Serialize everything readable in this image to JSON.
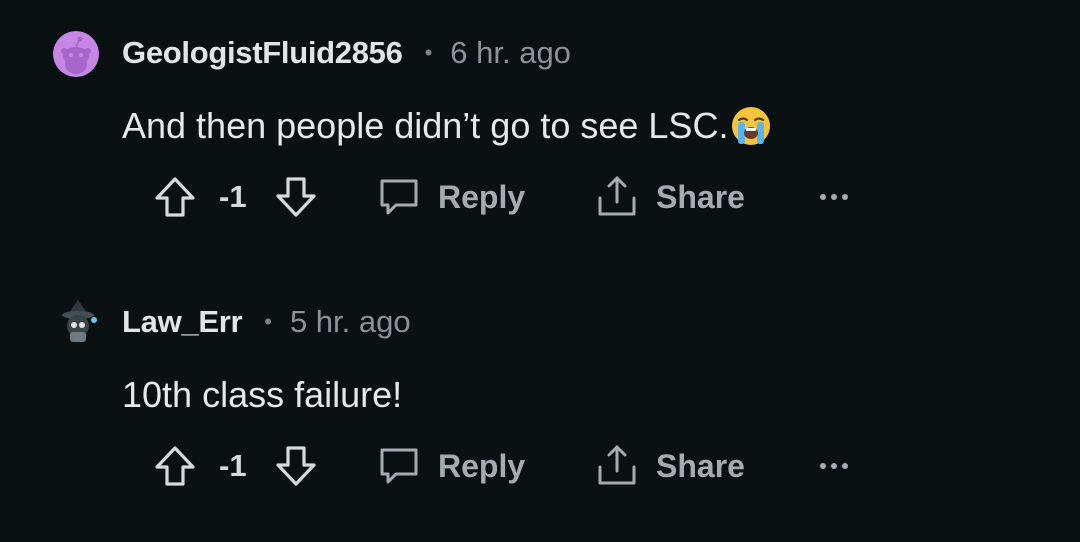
{
  "comments": [
    {
      "username": "GeologistFluid2856",
      "separator": "•",
      "time": "6 hr. ago",
      "text": "And then people didn’t go to see LSC.",
      "emoji": "loudly-crying-face-emoji",
      "score": "-1",
      "reply_label": "Reply",
      "share_label": "Share",
      "avatar_icon": "reddit-snoo-avatar",
      "avatar_color": "#c785e6"
    },
    {
      "username": "Law_Err",
      "separator": "•",
      "time": "5 hr. ago",
      "text": "10th class failure!",
      "score": "-1",
      "reply_label": "Reply",
      "share_label": "Share",
      "avatar_icon": "wizard-avatar",
      "avatar_color": "#3a4448"
    }
  ]
}
